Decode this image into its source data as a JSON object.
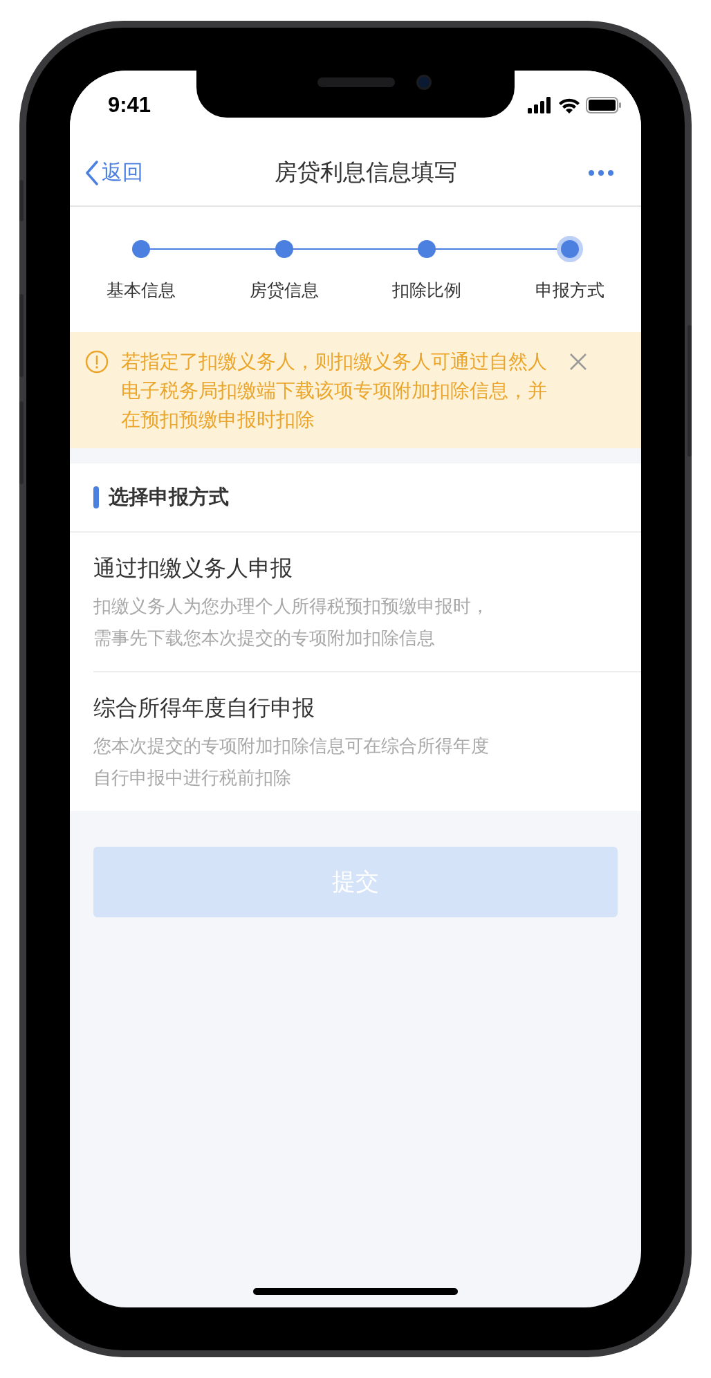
{
  "status_bar": {
    "time": "9:41"
  },
  "nav": {
    "back": "返回",
    "title": "房贷利息信息填写"
  },
  "steps": [
    {
      "label": "基本信息",
      "selected": false
    },
    {
      "label": "房贷信息",
      "selected": false
    },
    {
      "label": "扣除比例",
      "selected": false
    },
    {
      "label": "申报方式",
      "selected": true
    }
  ],
  "notice": {
    "text": "若指定了扣缴义务人，则扣缴义务人可通过自然人电子税务局扣缴端下载该项专项附加扣除信息，并在预扣预缴申报时扣除"
  },
  "section": {
    "title": "选择申报方式"
  },
  "options": [
    {
      "title": "通过扣缴义务人申报",
      "description": [
        "扣缴义务人为您办理个人所得税预扣预缴申报时，",
        "需事先下载您本次提交的专项附加扣除信息"
      ]
    },
    {
      "title": "综合所得年度自行申报",
      "description": [
        "您本次提交的专项附加扣除信息可在综合所得年度",
        "自行申报中进行税前扣除"
      ]
    }
  ],
  "submit": {
    "label": "提交",
    "disabled": true
  }
}
